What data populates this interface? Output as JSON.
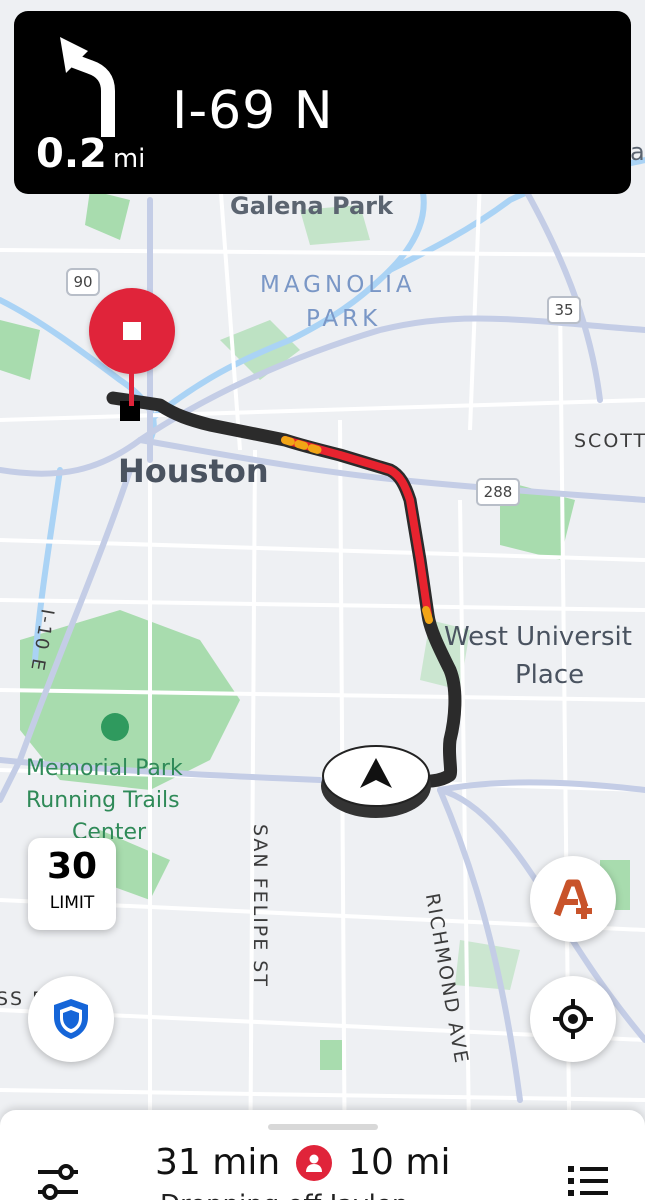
{
  "navigation": {
    "street": "I-69 N",
    "distance_value": "0.2",
    "distance_unit": "mi",
    "maneuver_icon": "turn-left-arrow-icon"
  },
  "map": {
    "labels": {
      "galena_park": "Galena Park",
      "magnolia": "MAGNOLIA",
      "park": "PARK",
      "houston": "Houston",
      "scott": "SCOTT",
      "west_university": "West Universit",
      "place": "Place",
      "memorial_park_1": "Memorial Park",
      "memorial_park_2": "Running Trails",
      "memorial_park_3": "Center",
      "san_felipe": "SAN FELIPE ST",
      "richmond": "RICHMOND AVE",
      "i10": "I-10 E",
      "partial_left": "SS P",
      "partial_right_top": "a"
    },
    "shields": {
      "us90": "90",
      "tx35": "35",
      "tx288": "288"
    }
  },
  "speed_limit": {
    "value": "30",
    "label": "LIMIT"
  },
  "trip": {
    "time": "31 min",
    "distance": "10 mi",
    "status": "Dropping off Jaylen"
  },
  "colors": {
    "route_dark": "#2b2b2b",
    "route_heavy_traffic": "#e8232f",
    "route_moderate_traffic": "#f2a516",
    "destination_pin": "#e0243a",
    "safety_shield": "#1565d8",
    "hazard_icon": "#c8532a",
    "park_green": "#a8dcae",
    "water_blue": "#aad3f5"
  }
}
